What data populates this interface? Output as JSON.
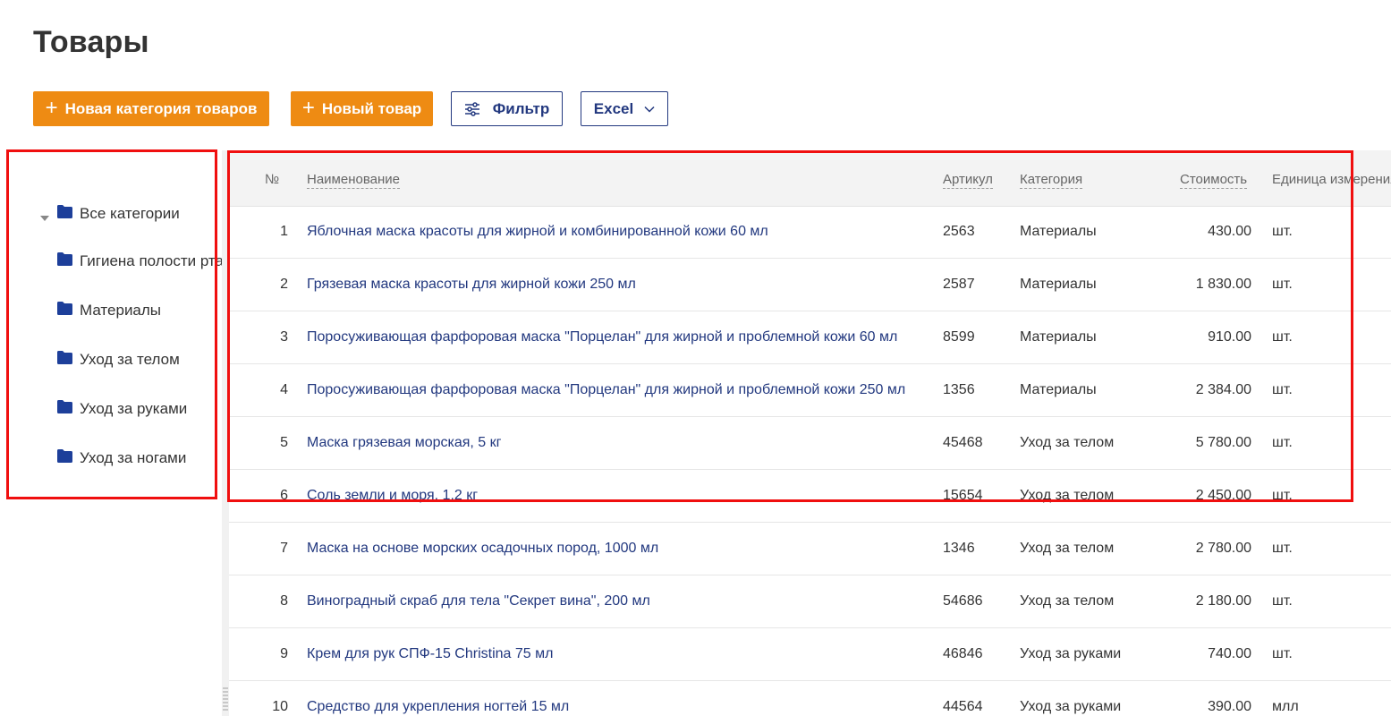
{
  "page": {
    "title": "Товары"
  },
  "toolbar": {
    "new_category": "Новая категория товаров",
    "new_product": "Новый товар",
    "filter": "Фильтр",
    "excel": "Excel"
  },
  "sidebar": {
    "items": [
      {
        "label": "Все категории",
        "expanded": true
      },
      {
        "label": "Гигиена полости рта"
      },
      {
        "label": "Материалы"
      },
      {
        "label": "Уход за телом"
      },
      {
        "label": "Уход за руками"
      },
      {
        "label": "Уход за ногами"
      }
    ]
  },
  "table": {
    "columns": [
      "№",
      "Наименование",
      "Артикул",
      "Категория",
      "Стоимость",
      "Единица измерения"
    ],
    "rows": [
      {
        "num": "1",
        "name": "Яблочная маска красоты для жирной и комбинированной кожи 60 мл",
        "sku": "2563",
        "category": "Материалы",
        "cost": "430.00",
        "unit": "шт."
      },
      {
        "num": "2",
        "name": "Грязевая маска красоты для жирной кожи 250 мл",
        "sku": "2587",
        "category": "Материалы",
        "cost": "1 830.00",
        "unit": "шт."
      },
      {
        "num": "3",
        "name": "Поросуживающая фарфоровая маска \"Порцелан\" для жирной и проблемной кожи 60 мл",
        "sku": "8599",
        "category": "Материалы",
        "cost": "910.00",
        "unit": "шт."
      },
      {
        "num": "4",
        "name": "Поросуживающая фарфоровая маска \"Порцелан\" для жирной и проблемной кожи 250 мл",
        "sku": "1356",
        "category": "Материалы",
        "cost": "2 384.00",
        "unit": "шт."
      },
      {
        "num": "5",
        "name": "Маска грязевая морская, 5 кг",
        "sku": "45468",
        "category": "Уход за телом",
        "cost": "5 780.00",
        "unit": "шт."
      },
      {
        "num": "6",
        "name": "Соль земли и моря, 1,2 кг",
        "sku": "15654",
        "category": "Уход за телом",
        "cost": "2 450.00",
        "unit": "шт."
      },
      {
        "num": "7",
        "name": "Маска на основе морских осадочных пород, 1000 мл",
        "sku": "1346",
        "category": "Уход за телом",
        "cost": "2 780.00",
        "unit": "шт."
      },
      {
        "num": "8",
        "name": "Виноградный скраб для тела \"Секрет вина\", 200 мл",
        "sku": "54686",
        "category": "Уход за телом",
        "cost": "2 180.00",
        "unit": "шт."
      },
      {
        "num": "9",
        "name": "Крем для рук СПФ-15 Christina 75 мл",
        "sku": "46846",
        "category": "Уход за руками",
        "cost": "740.00",
        "unit": "шт."
      },
      {
        "num": "10",
        "name": "Средство для укрепления ногтей 15 мл",
        "sku": "44564",
        "category": "Уход за руками",
        "cost": "390.00",
        "unit": "млл"
      }
    ]
  },
  "colors": {
    "accent": "#ee8b13",
    "link": "#22387f",
    "highlight": "#f00f0f"
  }
}
